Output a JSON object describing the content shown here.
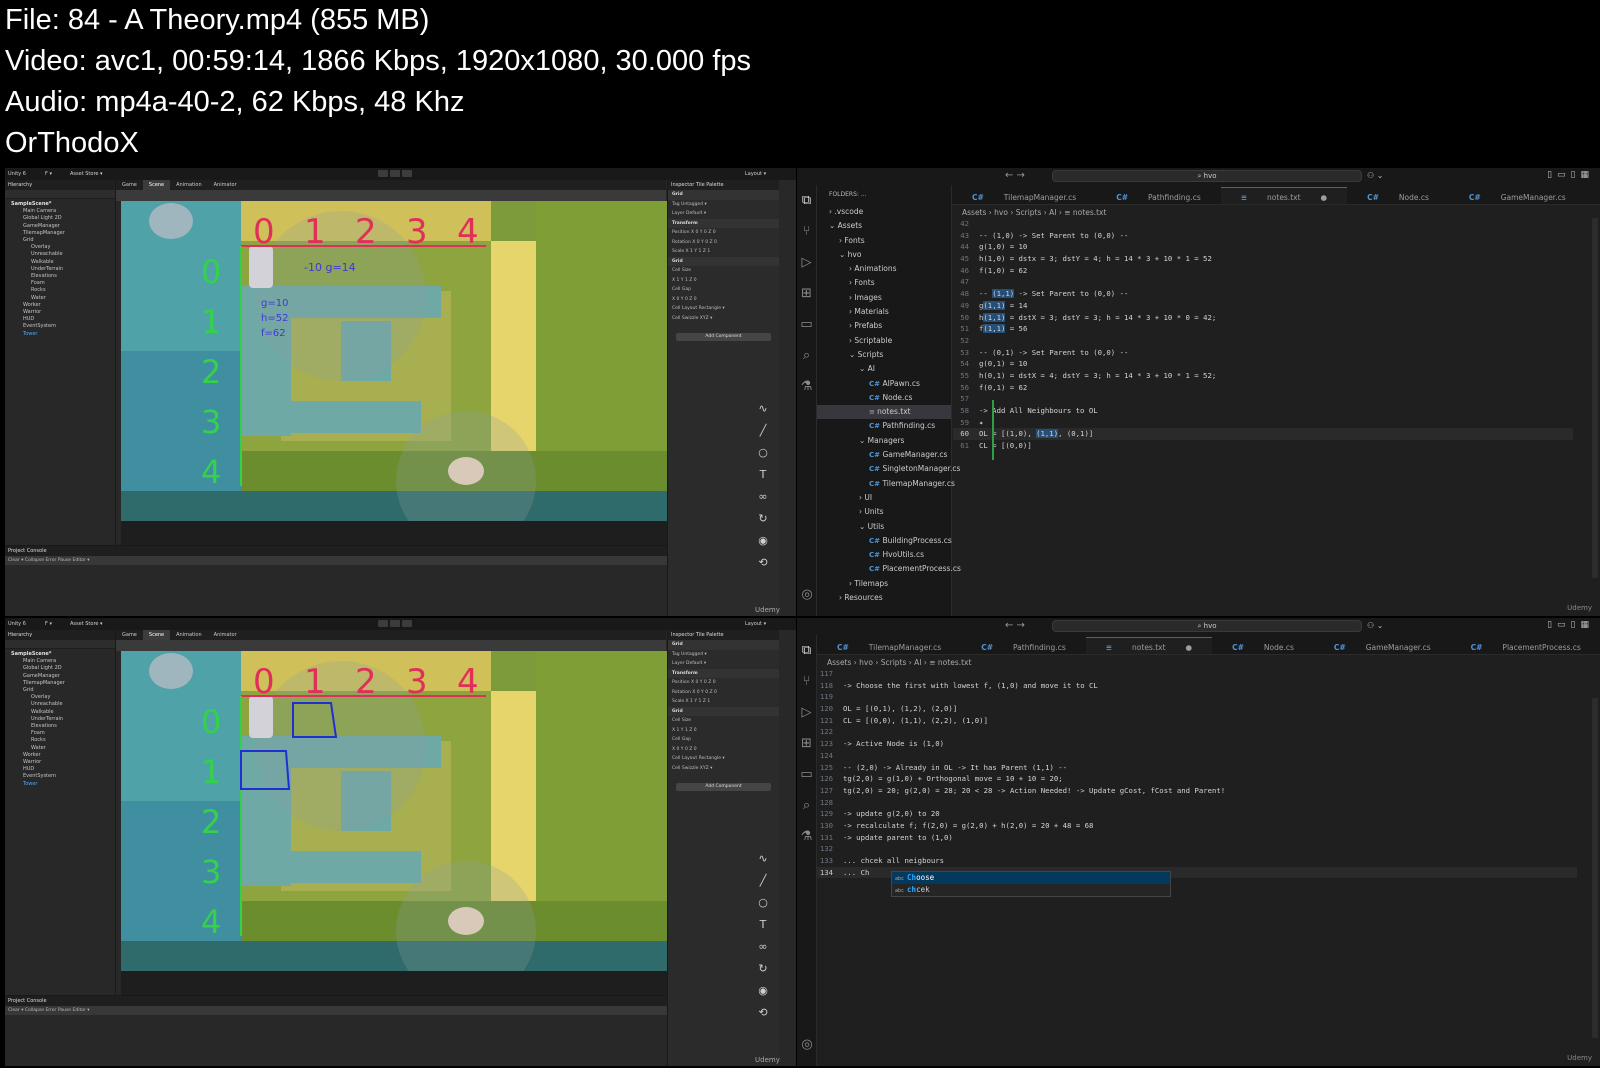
{
  "info": {
    "file": "File: 84 - A Theory.mp4 (855 MB)",
    "video": "Video: avc1, 00:59:14, 1866 Kbps, 1920x1080, 30.000 fps",
    "audio": "Audio: mp4a-40-2, 62 Kbps, 48 Khz",
    "author": "OrThodoX"
  },
  "unity": {
    "toolbar": {
      "project": "Unity 6",
      "file_menu": "F ▾",
      "asset_store": "Asset Store ▾",
      "layout": "Layout ▾"
    },
    "hierarchy": {
      "tab": "Hierarchy",
      "scene": "SampleScene*",
      "items": [
        "Main Camera",
        "Global Light 2D",
        "GameManager",
        "TilemapManager",
        "Grid",
        "Overlay",
        "Unreachable",
        "Walkable",
        "UnderTerrain",
        "Elevations",
        "Foam",
        "Rocks",
        "Water",
        "Worker",
        "Warrior",
        "HUD",
        "EventSystem",
        "Tower"
      ]
    },
    "scene_tabs": [
      "Game",
      "Scene",
      "Animation",
      "Animator"
    ],
    "scene": {
      "column_labels": [
        "0",
        "1",
        "2",
        "3",
        "4"
      ],
      "row_labels": [
        "0",
        "1",
        "2",
        "3",
        "4"
      ],
      "notes_top": [
        "-10",
        "g=14",
        "h=52",
        "g=10",
        "h=52",
        "f=62"
      ]
    },
    "project": {
      "tabs": "Project   Console",
      "tools": "Clear ▾  Collapse  Error Pause  Editor ▾"
    },
    "inspector": {
      "tabs": "Inspector   Tile Palette",
      "object": "Grid",
      "static": "Static ▾",
      "tag": "Tag  Untagged ▾",
      "layer": "Layer  Default ▾",
      "transform": "Transform",
      "position": "Position  X 0    Y 0    Z 0",
      "rotation": "Rotation  X 0    Y 0    Z 0",
      "scale": "Scale     X 1    Y 1    Z 1",
      "grid": "Grid",
      "cell_size": "Cell Size",
      "cell_size_val": "X 1    Y 1    Z 0",
      "cell_gap": "Cell Gap",
      "cell_gap_val": "X 0    Y 0    Z 0",
      "cell_layout": "Cell Layout   Rectangle ▾",
      "cell_swizzle": "Cell Swizzle  XYZ ▾",
      "add_component": "Add Component"
    },
    "udemy": "Udemy"
  },
  "vscode_top": {
    "search": "⌕ hvo",
    "explorer_head": "FOLDERS: ...",
    "tree": [
      {
        "label": "› .vscode",
        "indent": 0,
        "type": "folder"
      },
      {
        "label": "⌄ Assets",
        "indent": 0,
        "type": "folder"
      },
      {
        "label": "› Fonts",
        "indent": 1,
        "type": "folder"
      },
      {
        "label": "⌄ hvo",
        "indent": 1,
        "type": "folder"
      },
      {
        "label": "› Animations",
        "indent": 2,
        "type": "folder"
      },
      {
        "label": "› Fonts",
        "indent": 2,
        "type": "folder"
      },
      {
        "label": "› Images",
        "indent": 2,
        "type": "folder"
      },
      {
        "label": "› Materials",
        "indent": 2,
        "type": "folder"
      },
      {
        "label": "› Prefabs",
        "indent": 2,
        "type": "folder"
      },
      {
        "label": "› Scriptable",
        "indent": 2,
        "type": "folder"
      },
      {
        "label": "⌄ Scripts",
        "indent": 2,
        "type": "folder"
      },
      {
        "label": "⌄ AI",
        "indent": 3,
        "type": "folder"
      },
      {
        "label": "AIPawn.cs",
        "indent": 4,
        "type": "cs"
      },
      {
        "label": "Node.cs",
        "indent": 4,
        "type": "cs"
      },
      {
        "label": "notes.txt",
        "indent": 4,
        "type": "txt"
      },
      {
        "label": "Pathfinding.cs",
        "indent": 4,
        "type": "cs"
      },
      {
        "label": "⌄ Managers",
        "indent": 3,
        "type": "folder"
      },
      {
        "label": "GameManager.cs",
        "indent": 4,
        "type": "cs"
      },
      {
        "label": "SingletonManager.cs",
        "indent": 4,
        "type": "cs"
      },
      {
        "label": "TilemapManager.cs",
        "indent": 4,
        "type": "cs"
      },
      {
        "label": "› UI",
        "indent": 3,
        "type": "folder"
      },
      {
        "label": "› Units",
        "indent": 3,
        "type": "folder"
      },
      {
        "label": "⌄ Utils",
        "indent": 3,
        "type": "folder"
      },
      {
        "label": "BuildingProcess.cs",
        "indent": 4,
        "type": "cs"
      },
      {
        "label": "HvoUtils.cs",
        "indent": 4,
        "type": "cs"
      },
      {
        "label": "PlacementProcess.cs",
        "indent": 4,
        "type": "cs"
      },
      {
        "label": "› Tilemaps",
        "indent": 2,
        "type": "folder"
      },
      {
        "label": "› Resources",
        "indent": 1,
        "type": "folder"
      }
    ],
    "tabs": [
      "TilemapManager.cs",
      "Pathfinding.cs",
      "notes.txt",
      "Node.cs",
      "GameManager.cs",
      "PlacementProcess.cs"
    ],
    "active_tab": 2,
    "breadcrumb": "Assets › hvo › Scripts › AI › ≡ notes.txt",
    "lines": [
      {
        "n": "42",
        "t": ""
      },
      {
        "n": "43",
        "t": "-- (1,0) -> Set Parent to (0,0) --"
      },
      {
        "n": "44",
        "t": "g(1,0) = 10"
      },
      {
        "n": "45",
        "t": "h(1,0) = dstx = 3; dstY = 4; h = 14 * 3 + 10 * 1 = 52"
      },
      {
        "n": "46",
        "t": "f(1,0) = 62"
      },
      {
        "n": "47",
        "t": ""
      },
      {
        "n": "48",
        "t": "-- (1,1) -> Set Parent to (0,0) --"
      },
      {
        "n": "49",
        "t": "g(1,1) = 14"
      },
      {
        "n": "50",
        "t": "h(1,1) = dstX = 3; dstY = 3; h = 14 * 3 + 10 * 0 = 42;"
      },
      {
        "n": "51",
        "t": "f(1,1) = 56"
      },
      {
        "n": "52",
        "t": ""
      },
      {
        "n": "53",
        "t": "-- (0,1) -> Set Parent to (0,0) --"
      },
      {
        "n": "54",
        "t": "g(0,1) = 10"
      },
      {
        "n": "55",
        "t": "h(0,1) = dstX = 4; dstY = 3; h = 14 * 3 + 10 * 1 = 52;"
      },
      {
        "n": "56",
        "t": "f(0,1) = 62"
      },
      {
        "n": "57",
        "t": ""
      },
      {
        "n": "58",
        "t": "-> Add All Neighbours to OL"
      },
      {
        "n": "59",
        "t": "✦"
      },
      {
        "n": "60",
        "t": "OL = [(1,0), (1,1), (0,1)]"
      },
      {
        "n": "61",
        "t": "CL = [(0,0)]"
      }
    ],
    "udemy": "Udemy"
  },
  "vscode_bottom": {
    "search": "⌕ hvo",
    "tabs": [
      "TilemapManager.cs",
      "Pathfinding.cs",
      "notes.txt",
      "Node.cs",
      "GameManager.cs",
      "PlacementProcess.cs"
    ],
    "active_tab": 2,
    "breadcrumb": "Assets › hvo › Scripts › AI › ≡ notes.txt",
    "lines": [
      {
        "n": "117",
        "t": ""
      },
      {
        "n": "118",
        "t": "-> Choose the first with lowest f, (1,0) and move it to CL"
      },
      {
        "n": "119",
        "t": ""
      },
      {
        "n": "120",
        "t": "OL = [(0,1), (1,2), (2,0)]"
      },
      {
        "n": "121",
        "t": "CL = [(0,0), (1,1), (2,2), (1,0)]"
      },
      {
        "n": "122",
        "t": ""
      },
      {
        "n": "123",
        "t": "-> Active Node is (1,0)"
      },
      {
        "n": "124",
        "t": ""
      },
      {
        "n": "125",
        "t": "-- (2,0) -> Already in OL -> It has Parent (1,1) --"
      },
      {
        "n": "126",
        "t": "tg(2,0) = g(1,0) + Orthogonal move = 10 + 10 = 20;"
      },
      {
        "n": "127",
        "t": "tg(2,0) = 20; g(2,0) = 28; 20 < 28 -> Action Needed! -> Update gCost, fCost and Parent!"
      },
      {
        "n": "128",
        "t": ""
      },
      {
        "n": "129",
        "t": "-> update g(2,0) to 20"
      },
      {
        "n": "130",
        "t": "-> recalculate f; f(2,0) = g(2,0) + h(2,0) = 20 + 48 = 68"
      },
      {
        "n": "131",
        "t": "-> update parent to (1,0)"
      },
      {
        "n": "132",
        "t": ""
      },
      {
        "n": "133",
        "t": "... chcek all neigbours"
      },
      {
        "n": "134",
        "t": "... Ch"
      }
    ],
    "suggest": [
      {
        "kind": "abc",
        "match": "Ch",
        "rest": "oose"
      },
      {
        "kind": "abc",
        "match": "ch",
        "rest": "cek"
      }
    ],
    "udemy": "Udemy"
  }
}
